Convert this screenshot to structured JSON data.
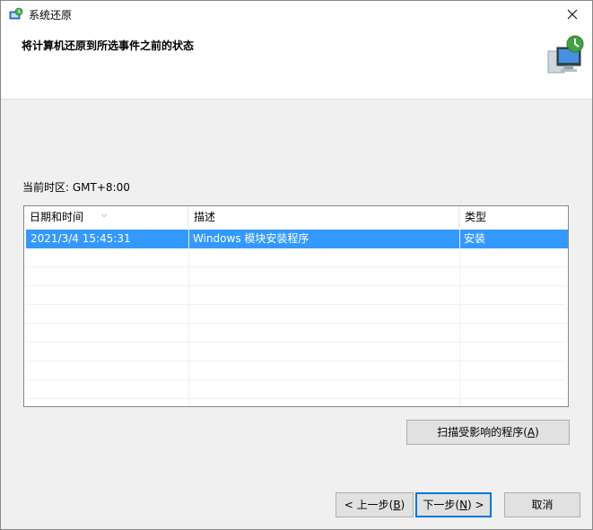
{
  "window": {
    "title": "系统还原",
    "heading": "将计算机还原到所选事件之前的状态"
  },
  "timezone_label": "当前时区: GMT+8:00",
  "table": {
    "columns": [
      "日期和时间",
      "描述",
      "类型"
    ],
    "rows": [
      {
        "datetime": "2021/3/4 15:45:31",
        "description": "Windows 模块安装程序",
        "type": "安装",
        "selected": true
      }
    ]
  },
  "buttons": {
    "scan_prefix": "扫描受影响的程序(",
    "scan_key": "A",
    "scan_suffix": ")",
    "back_prefix": "< 上一步(",
    "back_key": "B",
    "back_suffix": ")",
    "next_prefix": "下一步(",
    "next_key": "N",
    "next_suffix": ") >",
    "cancel": "取消"
  },
  "icons": {
    "app": "system-restore-icon",
    "header": "system-restore-computer-icon",
    "close": "close-icon",
    "sort": "sort-arrow-icon"
  },
  "colors": {
    "selection": "#3399ff",
    "default_button_border": "#0078d7",
    "button_bg": "#e1e1e1"
  }
}
